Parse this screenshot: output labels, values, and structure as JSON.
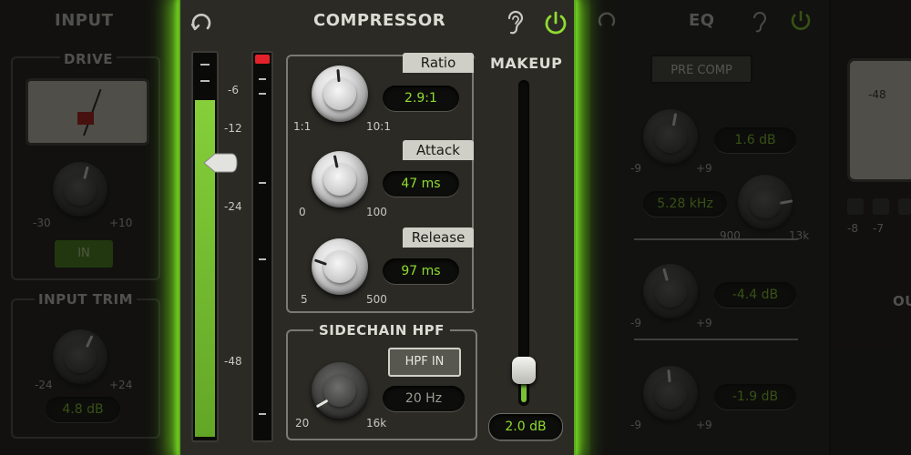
{
  "left_panel": {
    "title": "INPUT",
    "drive_label": "DRIVE",
    "drive_min": "-30",
    "drive_max": "+10",
    "in_button": "IN",
    "input_trim_label": "INPUT TRIM",
    "trim_min": "-24",
    "trim_max": "+24",
    "trim_value": "4.8 dB"
  },
  "compressor": {
    "title": "COMPRESSOR",
    "meter_scale": [
      "-6",
      "-12",
      "-24",
      "-48"
    ],
    "ratio": {
      "label": "Ratio",
      "value": "2.9:1",
      "min": "1:1",
      "max": "10:1"
    },
    "attack": {
      "label": "Attack",
      "value": "47 ms",
      "min": "0",
      "max": "100"
    },
    "release": {
      "label": "Release",
      "value": "97 ms",
      "min": "5",
      "max": "500"
    },
    "makeup": {
      "label": "MAKEUP",
      "value": "2.0 dB"
    },
    "sidechain": {
      "label": "SIDECHAIN HPF",
      "button": "HPF IN",
      "value": "20 Hz",
      "min": "20",
      "max": "16k"
    }
  },
  "eq_panel": {
    "title": "EQ",
    "pre_comp_button": "PRE COMP",
    "low_gain": "1.6 dB",
    "low_min": "-9",
    "low_max": "+9",
    "mid_freq": "5.28 kHz",
    "mid_freq_min": "900",
    "mid_freq_max": "13k",
    "mid_gain": "-4.4 dB",
    "mid_min": "-9",
    "mid_max": "+9",
    "high_gain": "-1.9 dB",
    "high_min": "-9",
    "high_max": "+9"
  },
  "far_panel": {
    "vu_reading": "-48",
    "scale": [
      "-8",
      "-7"
    ],
    "label": "OU"
  },
  "colors": {
    "accent_green": "#8fdc30",
    "glow": "#6fd11e",
    "meter_fill": "#7bc234",
    "clip_red": "#e2222a"
  },
  "icons": {
    "reset": "reset-icon",
    "listen": "ear-icon",
    "power": "power-icon"
  }
}
